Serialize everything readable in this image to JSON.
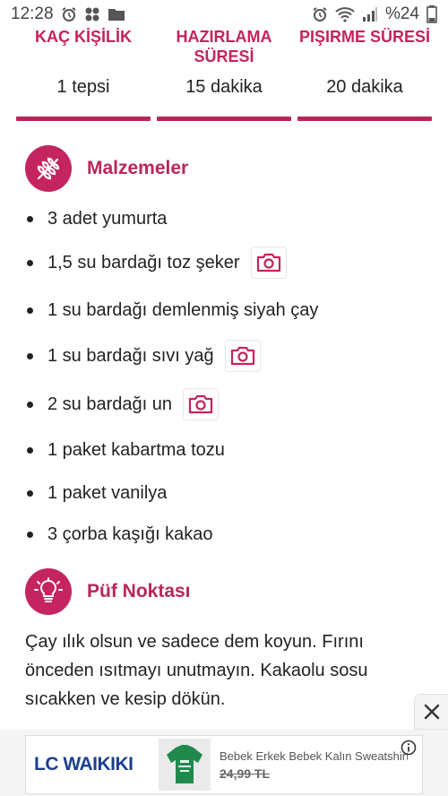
{
  "status_bar": {
    "time": "12:28",
    "battery": "%24"
  },
  "stats": [
    {
      "label": "KAÇ KİŞİLİK",
      "value": "1 tepsi"
    },
    {
      "label": "HAZIRLAMA SÜRESİ",
      "value": "15 dakika"
    },
    {
      "label": "PIŞIRME SÜRESİ",
      "value": "20 dakika"
    }
  ],
  "ingredients_section": {
    "title": "Malzemeler",
    "items": [
      {
        "text": "3 adet yumurta",
        "has_photo": false
      },
      {
        "text": "1,5 su bardağı toz şeker",
        "has_photo": true
      },
      {
        "text": "1 su bardağı demlenmiş siyah çay",
        "has_photo": false
      },
      {
        "text": "1 su bardağı sıvı yağ",
        "has_photo": true
      },
      {
        "text": "2 su bardağı un",
        "has_photo": true
      },
      {
        "text": "1 paket kabartma tozu",
        "has_photo": false
      },
      {
        "text": "1 paket vanilya",
        "has_photo": false
      },
      {
        "text": "3 çorba kaşığı kakao",
        "has_photo": false
      }
    ]
  },
  "tip_section": {
    "title": "Püf Noktası",
    "text": "Çay ılık olsun ve sadece dem koyun. Fırını önceden ısıtmayı unutmayın. Kakaolu sosu sıcakken ve kesip dökün."
  },
  "ad": {
    "brand": "LC WAIKIKI",
    "product_title": "Bebek Erkek Bebek Kalın Sweatshirt",
    "price": "24,99 TL"
  },
  "colors": {
    "accent": "#c4245b",
    "bar": "#b8265b"
  },
  "icons": {
    "ingredients_badge": "wheat-icon",
    "tip_badge": "lightbulb-icon",
    "photo": "camera-icon",
    "close": "close-icon",
    "info": "info-icon"
  }
}
